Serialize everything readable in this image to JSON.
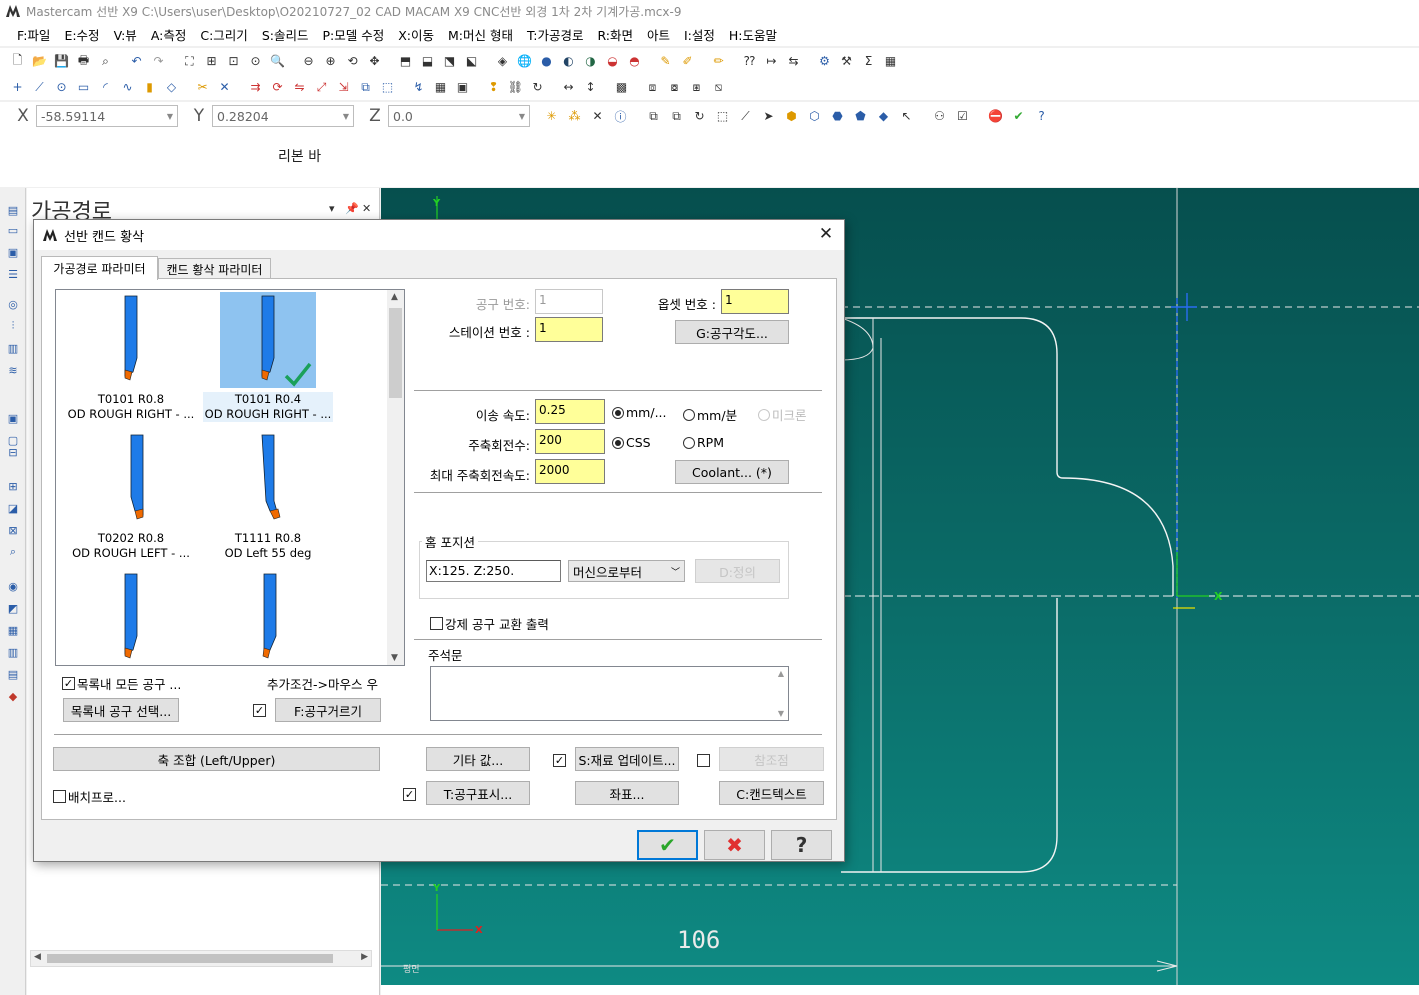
{
  "window": {
    "title": "Mastercam 선반 X9   C:\\Users\\user\\Desktop\\O20210727_02 CAD MACAM X9 CNC선반 외경 1차 2차 기계가공.mcx-9"
  },
  "menu": [
    "F:파일",
    "E:수정",
    "V:뷰",
    "A:측정",
    "C:그리기",
    "S:솔리드",
    "P:모델 수정",
    "X:이동",
    "M:머신 형태",
    "T:가공경로",
    "R:화면",
    "아트",
    "I:설정",
    "H:도움말"
  ],
  "coords": {
    "x_label": "X",
    "x_value": "-58.59114",
    "y_label": "Y",
    "y_value": "0.28204",
    "z_label": "Z",
    "z_value": "0.0"
  },
  "ribbon": {
    "label": "리본 바"
  },
  "ops_panel": {
    "title": "가공경로",
    "pin": "▾ ꟷ",
    "close": "✕"
  },
  "graphics": {
    "dimension_label": "106",
    "axis_x": "X",
    "axis_y": "Y",
    "bottom_label": "평면"
  },
  "dialog": {
    "title": "선반 캔드 황삭",
    "close": "✕",
    "tabs": [
      "가공경로 파라미터",
      "캔드 황삭 파라미터"
    ],
    "tools": [
      {
        "line1": "T0101 R0.8",
        "line2": "OD ROUGH RIGHT - ...",
        "selected": false
      },
      {
        "line1": "T0101 R0.4",
        "line2": "OD ROUGH RIGHT - ...",
        "selected": true
      },
      {
        "line1": "T0202 R0.8",
        "line2": "OD ROUGH LEFT - ...",
        "selected": false
      },
      {
        "line1": "T1111 R0.8",
        "line2": "OD Left 55 deg",
        "selected": false
      }
    ],
    "show_all_tools": "목록내 모든 공구 ...",
    "extra_hint": "추가조건->마우스 우",
    "select_tool_btn": "목록내 공구 선택...",
    "filter_btn": "F:공구거르기",
    "tool_no_label": "공구 번호:",
    "tool_no": "1",
    "offset_label": "옵셋 번호 :",
    "offset": "1",
    "station_label": "스테이션 번호 :",
    "station": "1",
    "angle_btn": "G:공구각도...",
    "feed_label": "이송 속도:",
    "feed": "0.25",
    "feed_units": [
      "mm/...",
      "mm/분",
      "미크론"
    ],
    "spindle_label": "주축회전수:",
    "spindle": "200",
    "spindle_modes": [
      "CSS",
      "RPM"
    ],
    "max_spindle_label": "최대 주축회전속도:",
    "max_spindle": "2000",
    "coolant_btn": "Coolant... (*)",
    "home_group": "홈 포지션",
    "home_value": "X:125.  Z:250.",
    "home_combo": "머신으로부터",
    "home_btn": "D:정의",
    "force_tool_change": "강제 공구 교환 출력",
    "comment_group": "주석문",
    "axis_combo_btn": "축 조합 (Left/Upper)",
    "misc_values_btn": "기타 값...",
    "stock_update_btn": "S:재료 업데이트...",
    "ref_point_btn": "참조점",
    "batch": "배치프로...",
    "tool_display_btn": "T:공구표시...",
    "coords_btn": "좌표...",
    "canned_text_btn": "C:캔드텍스트",
    "ok_icon": "✔",
    "cancel_icon": "✖",
    "help_icon": "?"
  },
  "colors": {
    "field_yellow": "#ffff99",
    "selection_blue": "#8ec3f0",
    "ok_green": "#2aa62a",
    "cancel_red": "#e03030",
    "tool_blue": "#1e7be8",
    "insert_orange": "#f06a00"
  }
}
